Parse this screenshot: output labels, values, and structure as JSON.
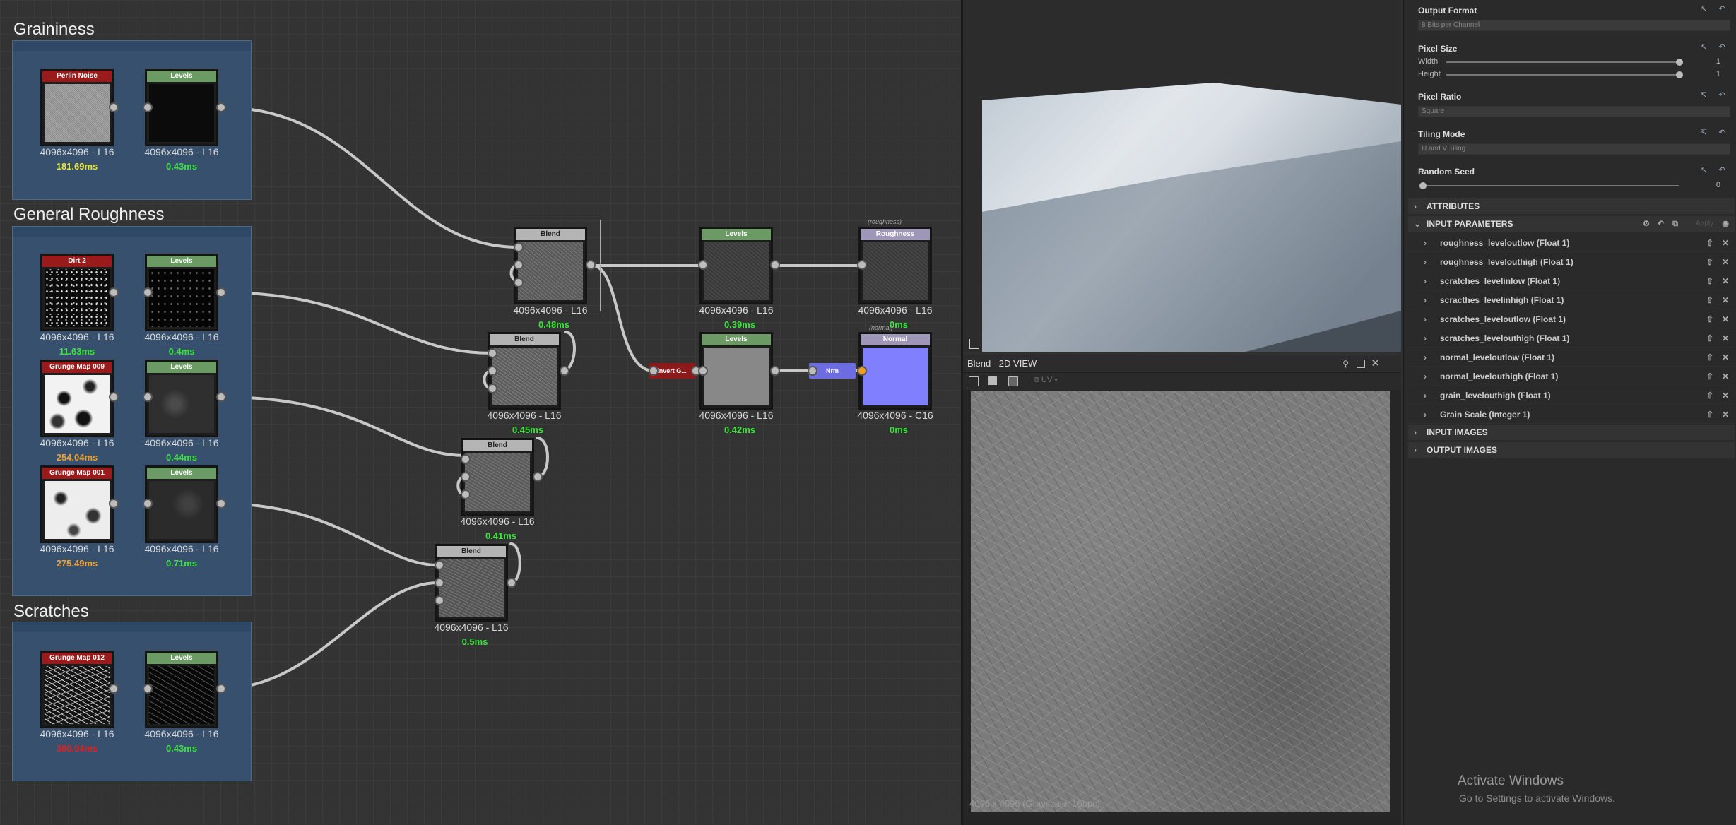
{
  "frames": [
    {
      "title": "Graininess"
    },
    {
      "title": "General Roughness"
    },
    {
      "title": "Scratches"
    }
  ],
  "nodes": {
    "perlin": {
      "title": "Perlin Noise",
      "res": "4096x4096 - L16",
      "time": "181.69ms"
    },
    "levels_g": {
      "title": "Levels",
      "res": "4096x4096 - L16",
      "time": "0.43ms"
    },
    "dirt2": {
      "title": "Dirt 2",
      "res": "4096x4096 - L16",
      "time": "11.63ms"
    },
    "levels_d": {
      "title": "Levels",
      "res": "4096x4096 - L16",
      "time": "0.4ms"
    },
    "grunge009": {
      "title": "Grunge Map 009",
      "res": "4096x4096 - L16",
      "time": "254.04ms"
    },
    "levels_g9": {
      "title": "Levels",
      "res": "4096x4096 - L16",
      "time": "0.44ms"
    },
    "grunge001": {
      "title": "Grunge Map 001",
      "res": "4096x4096 - L16",
      "time": "275.49ms"
    },
    "levels_g1": {
      "title": "Levels",
      "res": "4096x4096 - L16",
      "time": "0.71ms"
    },
    "grunge012": {
      "title": "Grunge Map 012",
      "res": "4096x4096 - L16",
      "time": "380.04ms"
    },
    "levels_s": {
      "title": "Levels",
      "res": "4096x4096 - L16",
      "time": "0.43ms"
    },
    "blend1": {
      "title": "Blend",
      "res": "4096x4096 - L16",
      "time": "0.48ms"
    },
    "blend2": {
      "title": "Blend",
      "res": "4096x4096 - L16",
      "time": "0.45ms"
    },
    "blend3": {
      "title": "Blend",
      "res": "4096x4096 - L16",
      "time": "0.41ms"
    },
    "blend4": {
      "title": "Blend",
      "res": "4096x4096 - L16",
      "time": "0.5ms"
    },
    "levels_r": {
      "title": "Levels",
      "res": "4096x4096 - L16",
      "time": "0.39ms"
    },
    "levels_n": {
      "title": "Levels",
      "res": "4096x4096 - L16",
      "time": "0.42ms"
    },
    "roughness": {
      "title": "Roughness",
      "sublabel": "(roughness)",
      "res": "4096x4096 - L16",
      "time": "0ms"
    },
    "normal": {
      "title": "Normal",
      "sublabel": "(normal)",
      "res": "4096x4096 - C16",
      "time": "0ms"
    },
    "invert": {
      "title": "Invert G..."
    },
    "nrm": {
      "title": "Nrm"
    }
  },
  "view2d": {
    "title": "Blend - 2D VIEW",
    "uv_label": "UV",
    "status": "4096 x 4096 (Grayscale, 16bpc)"
  },
  "properties": {
    "output_format": {
      "label": "Output Format",
      "value": "8 Bits per Channel"
    },
    "pixel_size": {
      "label": "Pixel Size",
      "width_label": "Width",
      "width_value": "1",
      "height_label": "Height",
      "height_value": "1"
    },
    "pixel_ratio": {
      "label": "Pixel Ratio",
      "value": "Square"
    },
    "tiling_mode": {
      "label": "Tiling Mode",
      "value": "H and V Tiling"
    },
    "random_seed": {
      "label": "Random Seed",
      "value": "0"
    },
    "sections": {
      "attributes": "ATTRIBUTES",
      "input_parameters": "INPUT PARAMETERS",
      "apply": "Apply",
      "input_images": "INPUT IMAGES",
      "output_images": "OUTPUT IMAGES"
    },
    "params": [
      "roughness_leveloutlow (Float 1)",
      "roughness_levelouthigh (Float 1)",
      "scratches_levelinlow (Float 1)",
      "scracthes_levelinhigh (Float 1)",
      "scratches_leveloutlow (Float 1)",
      "scratches_levelouthigh (Float 1)",
      "normal_leveloutlow (Float 1)",
      "normal_levelouthigh (Float 1)",
      "grain_levelouthigh (Float 1)",
      "Grain Scale (Integer 1)"
    ]
  },
  "watermark": {
    "line1": "Activate Windows",
    "line2": "Go to Settings to activate Windows."
  },
  "colors": {
    "time_green": "#39e639",
    "time_yellow": "#e8e83a",
    "time_orange": "#f0a030",
    "time_red": "#e02020",
    "frame_bg": "#36506e"
  }
}
